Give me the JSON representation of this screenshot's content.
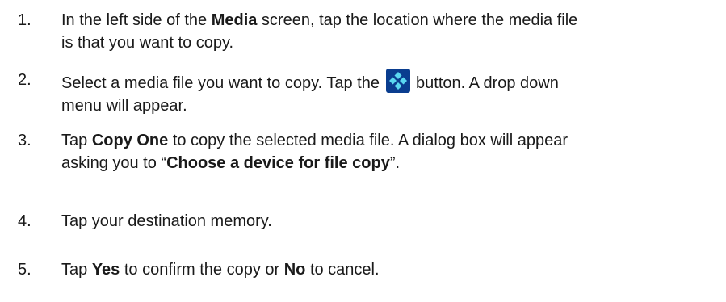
{
  "steps": [
    {
      "number": "1.",
      "line1_pre": "In the left side of the ",
      "line1_bold": "Media",
      "line1_post": " screen, tap the location where the media file",
      "line2": "is that you want to copy."
    },
    {
      "number": "2.",
      "line1_pre": "Select a media file you want to copy.  Tap the ",
      "icon": "menu-diamond-button-icon",
      "line1_post": " button.  A drop down",
      "line2": "menu will appear."
    },
    {
      "number": "3.",
      "line1_pre": "Tap ",
      "line1_bold": "Copy One",
      "line1_post": " to copy the selected media file.  A dialog box will appear",
      "line2_pre": "asking you to “",
      "line2_bold": "Choose a device for file copy",
      "line2_post": "”."
    },
    {
      "number": "4.",
      "line1": "Tap your destination memory."
    },
    {
      "number": "5.",
      "line1_pre": "Tap ",
      "line1_bold": "Yes",
      "line1_mid": " to confirm the copy or ",
      "line1_bold2": "No",
      "line1_post": " to cancel."
    }
  ],
  "colors": {
    "text": "#1a1a1a",
    "icon_bg": "#0a3d8f",
    "icon_diamond": "#5ad8f0"
  }
}
